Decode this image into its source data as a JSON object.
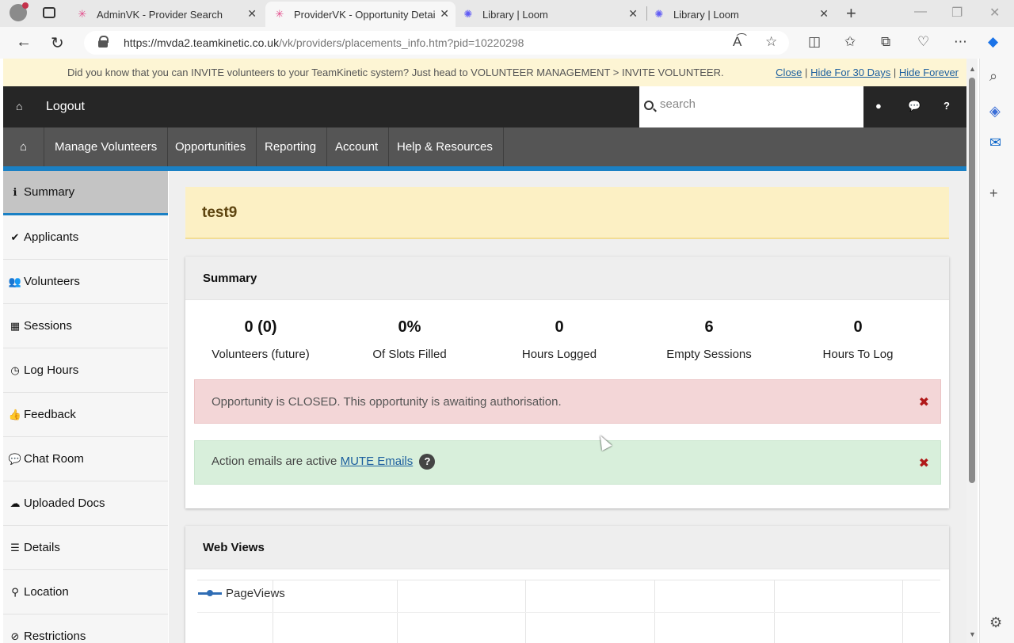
{
  "browser": {
    "tabs": [
      {
        "title": "AdminVK - Provider Search",
        "active": false
      },
      {
        "title": "ProviderVK - Opportunity Detai",
        "active": true
      },
      {
        "title": "Library | Loom",
        "active": false
      },
      {
        "title": "Library | Loom",
        "active": false
      }
    ],
    "url_base": "https://mvda2.teamkinetic.co.uk",
    "url_path": "/vk/providers/placements_info.htm?pid=10220298"
  },
  "notice": {
    "message": "Did you know that you can INVITE volunteers to your TeamKinetic system? Just head to VOLUNTEER MANAGEMENT > INVITE VOLUNTEER.",
    "close": "Close",
    "hide30": "Hide For 30 Days",
    "hide_forever": "Hide Forever",
    "sep": "|"
  },
  "topbar": {
    "logout": "Logout",
    "search_placeholder": "search"
  },
  "mainnav": [
    "Manage Volunteers",
    "Opportunities",
    "Reporting",
    "Account",
    "Help & Resources"
  ],
  "sidebar": [
    {
      "label": "Summary",
      "icon": "info-icon"
    },
    {
      "label": "Applicants",
      "icon": "check-icon"
    },
    {
      "label": "Volunteers",
      "icon": "users-icon"
    },
    {
      "label": "Sessions",
      "icon": "calendar-icon"
    },
    {
      "label": "Log Hours",
      "icon": "clock-icon"
    },
    {
      "label": "Feedback",
      "icon": "thumbs-up-icon"
    },
    {
      "label": "Chat Room",
      "icon": "chat-icon"
    },
    {
      "label": "Uploaded Docs",
      "icon": "cloud-upload-icon"
    },
    {
      "label": "Details",
      "icon": "list-icon"
    },
    {
      "label": "Location",
      "icon": "map-marker-icon"
    },
    {
      "label": "Restrictions",
      "icon": "ban-icon"
    }
  ],
  "page": {
    "title": "test9"
  },
  "summary": {
    "heading": "Summary",
    "stats": [
      {
        "value": "0 (0)",
        "label": "Volunteers (future)"
      },
      {
        "value": "0%",
        "label": "Of Slots Filled"
      },
      {
        "value": "0",
        "label": "Hours Logged"
      },
      {
        "value": "6",
        "label": "Empty Sessions"
      },
      {
        "value": "0",
        "label": "Hours To Log"
      }
    ],
    "alert_closed": "Opportunity is CLOSED. This opportunity is awaiting authorisation.",
    "alert_emails_text": "Action emails are active",
    "alert_emails_link": "MUTE Emails",
    "help_mark": "?"
  },
  "webviews": {
    "heading": "Web Views",
    "legend": "PageViews"
  },
  "colors": {
    "accent_blue": "#1a80c4",
    "topbar": "#262626",
    "nav": "#555555",
    "notice_bg": "#fdf5d4"
  }
}
